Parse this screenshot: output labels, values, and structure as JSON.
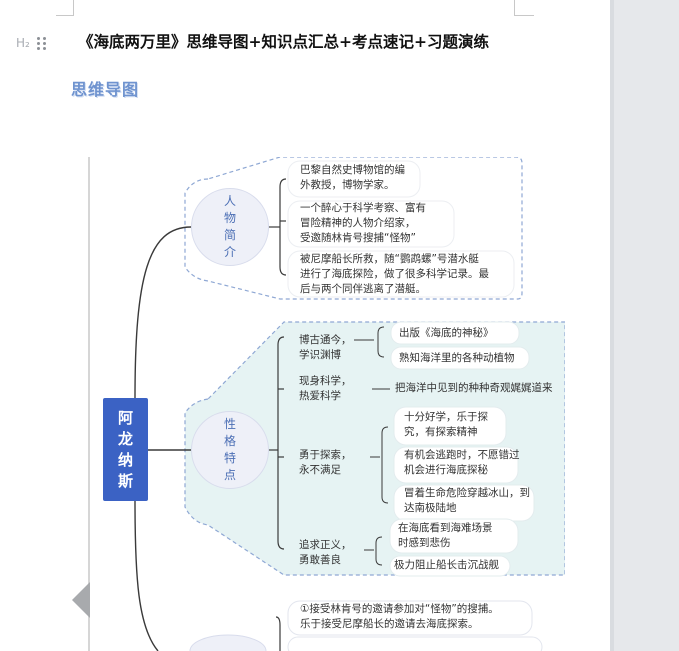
{
  "document": {
    "heading_badge": "H₂",
    "title": "《海底两万里》思维导图+知识点汇总+考点速记+习题演练",
    "section_heading": "思维导图"
  },
  "mindmap": {
    "root": [
      "阿",
      "龙",
      "纳",
      "斯"
    ],
    "branch_people": {
      "label": [
        "人",
        "物",
        "简",
        "介"
      ],
      "items": [
        [
          "巴黎自然史博物馆的编",
          "外教授，博物学家。"
        ],
        [
          "一个醉心于科学考察、富有",
          "冒险精神的人物介绍家，",
          "受邀随林肯号搜捕“怪物”"
        ],
        [
          "被尼摩船长所救，随“鹦鹉螺”号潜水艇",
          "进行了海底探险，做了很多科学记录。最",
          "后与两个同伴逃离了潜艇。"
        ]
      ]
    },
    "branch_traits": {
      "label": [
        "性",
        "格",
        "特",
        "点"
      ],
      "groups": [
        {
          "label": [
            "博古通今，",
            "学识渊博"
          ],
          "details": [
            [
              "出版《海底的神秘》"
            ],
            [
              "熟知海洋里的各种动植物"
            ]
          ]
        },
        {
          "label": [
            "现身科学，",
            "热爱科学"
          ],
          "details": [
            [
              "把海洋中见到的种种奇观娓娓道来"
            ]
          ]
        },
        {
          "label": [
            "勇于探索，",
            "永不满足"
          ],
          "details": [
            [
              "十分好学，乐于探",
              "究，有探索精神"
            ],
            [
              "有机会逃跑时，不愿错过",
              "机会进行海底探秘"
            ],
            [
              "冒着生命危险穿越冰山，到",
              "达南极陆地"
            ]
          ]
        },
        {
          "label": [
            "追求正义，",
            "勇敢善良"
          ],
          "details": [
            [
              "在海底看到海难场景",
              "时感到悲伤"
            ],
            [
              "极力阻止船长击沉战舰"
            ]
          ]
        }
      ]
    },
    "branch_third": {
      "items": [
        [
          "①接受林肯号的邀请参加对“怪物”的搜捕。",
          "乐于接受尼摩船长的邀请去海底探索。"
        ]
      ]
    }
  },
  "colors": {
    "root_box": "#3b62c4",
    "circle_fill": "#eef0f8",
    "circle_text": "#4c6fb5",
    "traits_fill": "#e6f3f3",
    "dashed_border": "#8fa8d4",
    "section_heading": "#6f93cf"
  }
}
